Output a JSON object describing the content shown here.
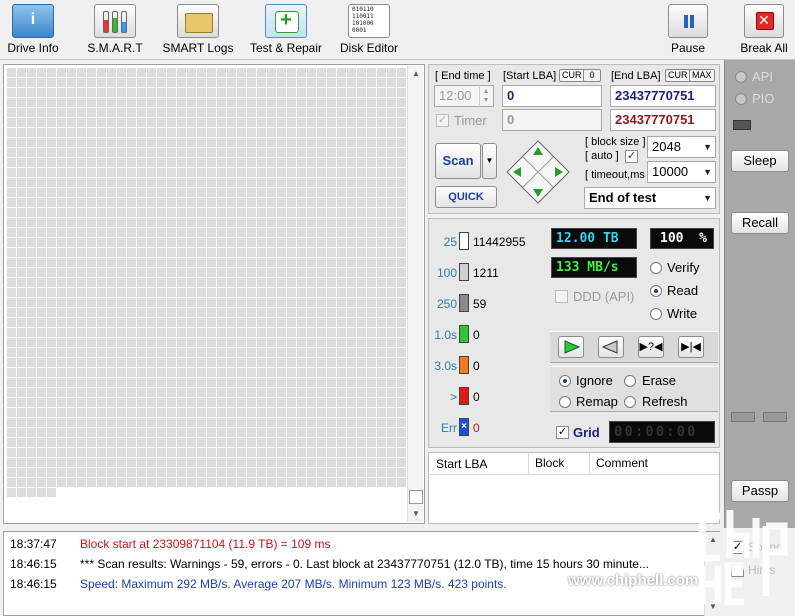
{
  "toolbar": {
    "buttons": [
      {
        "label": "Drive Info",
        "icon": "info-icon"
      },
      {
        "label": "S.M.A.R.T",
        "icon": "smart-icon"
      },
      {
        "label": "SMART Logs",
        "icon": "smart-logs-icon"
      },
      {
        "label": "Test & Repair",
        "icon": "test-repair-icon"
      },
      {
        "label": "Disk Editor",
        "icon": "disk-editor-icon"
      }
    ],
    "pause_label": "Pause",
    "break_label": "Break All",
    "disk_editor_glyph": "010110\n110011\n101000\n0001",
    "test_repair_glyph": "+",
    "info_glyph": "i",
    "break_glyph": "✕"
  },
  "scan": {
    "end_time_caption": "[ End time ]",
    "start_lba_caption": "[Start LBA]",
    "cur_label": "CUR",
    "zero_label": "0",
    "end_lba_caption": "[End LBA]",
    "max_label": "MAX",
    "end_time_value": "12:00",
    "start_lba_value": "0",
    "end_lba_value": "23437770751",
    "timer_label": "Timer",
    "timer_value": "0",
    "end_lba_value2": "23437770751",
    "scan_button": "Scan",
    "quick_button": "QUICK",
    "block_size_caption": "[ block size ]",
    "auto_caption": "[ auto ]",
    "block_size_value": "2048",
    "timeout_caption": "[ timeout,ms ]",
    "timeout_value": "10000",
    "end_action": "End of test"
  },
  "stats": {
    "rows": [
      {
        "label": "25",
        "value": "11442955",
        "color": "#ffffff"
      },
      {
        "label": "100",
        "value": "1211",
        "color": "#d0d0d0"
      },
      {
        "label": "250",
        "value": "59",
        "color": "#8a8a8a"
      },
      {
        "label": "1.0s",
        "value": "0",
        "color": "#2ec82e"
      },
      {
        "label": "3.0s",
        "value": "0",
        "color": "#f07a1c"
      },
      {
        "label": ">",
        "value": "0",
        "color": "#e01818"
      },
      {
        "label": "Err",
        "value": "0",
        "color": "#1a4ee0"
      }
    ],
    "capacity": "12.00 TB",
    "percent": "100",
    "percent_sign": "%",
    "speed": "133 MB/s",
    "ddd_label": "DDD (API)",
    "verify_label": "Verify",
    "read_label": "Read",
    "write_label": "Write",
    "ignore_label": "Ignore",
    "erase_label": "Erase",
    "remap_label": "Remap",
    "refresh_label": "Refresh",
    "grid_label": "Grid",
    "grid_timer": "00:00:00"
  },
  "results": {
    "columns": [
      "Start LBA",
      "Block",
      "Comment"
    ]
  },
  "side": {
    "api_label": "API",
    "pio_label": "PIO",
    "sleep_label": "Sleep",
    "recall_label": "Recall",
    "passp_label": "Passp",
    "sound_label": "Sound",
    "hints_label": "Hints"
  },
  "log": [
    {
      "time": "18:37:47",
      "msg": "Block start at 23309871104 (11.9 TB)  = 109 ms",
      "color": "#c01818"
    },
    {
      "time": "18:46:15",
      "msg": "*** Scan results: Warnings - 59, errors - 0. Last block at 23437770751 (12.0 TB), time 15 hours 30 minute...",
      "color": "#000000"
    },
    {
      "time": "18:46:15",
      "msg": "Speed: Maximum 292 MB/s. Average 207 MB/s. Minimum 123 MB/s. 423 points.",
      "color": "#1a3fb0"
    }
  ],
  "watermark": "www.chiphell.com"
}
